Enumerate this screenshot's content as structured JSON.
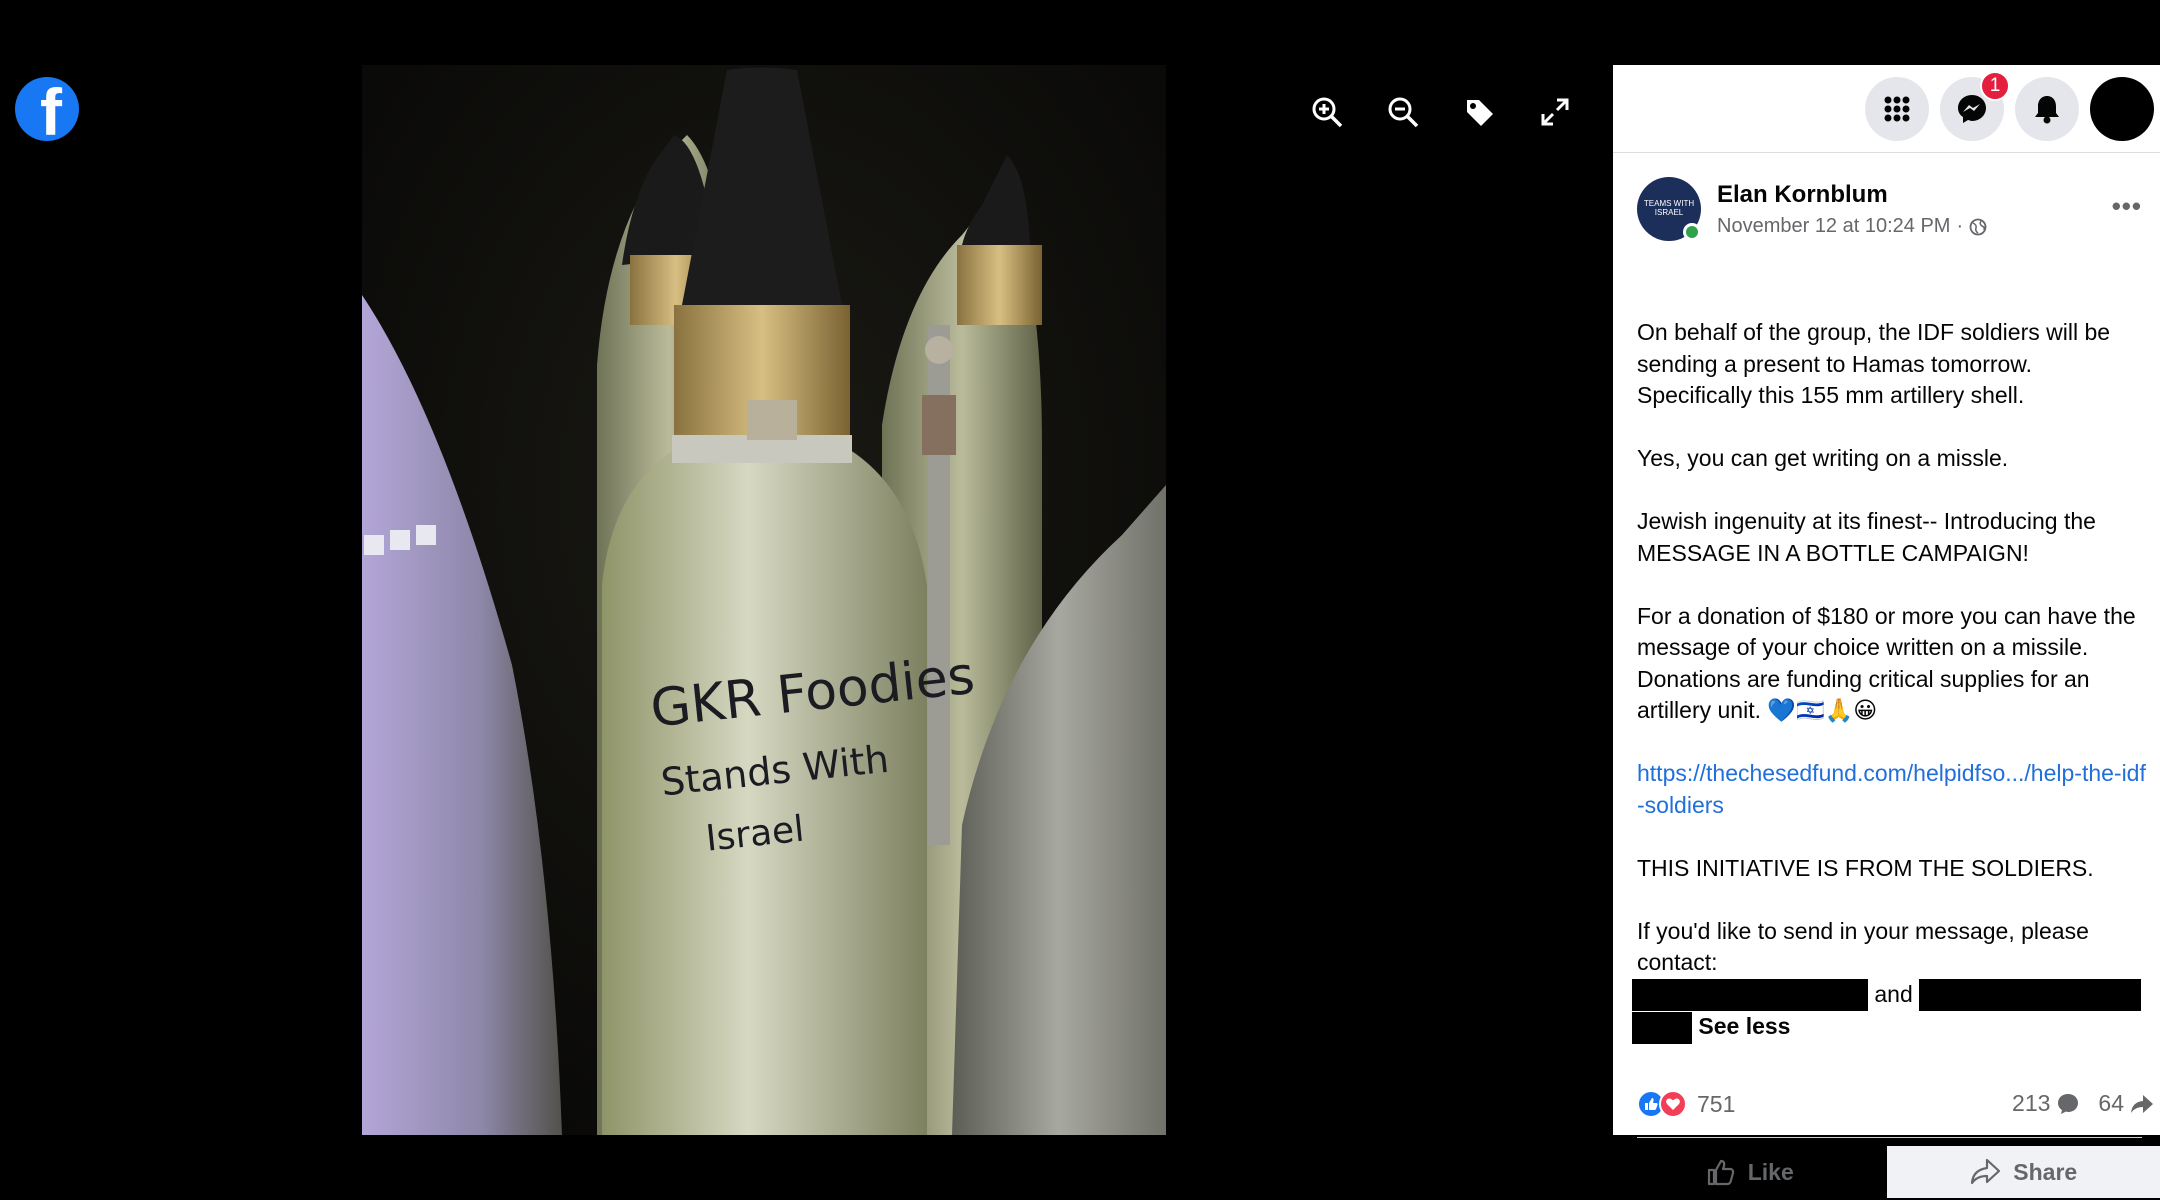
{
  "app": {
    "logo_letter": "f",
    "logo_icon": "facebook-logo"
  },
  "viewer": {
    "tools": [
      "zoom-in-icon",
      "zoom-out-icon",
      "tag-icon",
      "fullscreen-icon"
    ]
  },
  "photo": {
    "inscription_line1": "GKR Foodies",
    "inscription_line2": "Stands With",
    "inscription_line3": "Israel"
  },
  "topbar": {
    "messenger_badge": "1"
  },
  "post": {
    "author": "Elan Kornblum",
    "avatar_text": "TEAMS WITH ISRAEL",
    "timestamp": "November 12 at 10:24 PM",
    "separator": "·",
    "paragraphs": [
      "On behalf of the group, the IDF soldiers will be sending a present to Hamas tomorrow. Specifically this 155 mm artillery shell.",
      "Yes, you can get writing on a missle.",
      "Jewish ingenuity at its finest-- Introducing the MESSAGE IN A BOTTLE CAMPAIGN!",
      "For a donation of $180 or more you can have the message of your choice written on a missile. Donations are funding critical supplies for an artillery unit. 💙🇮🇱🙏😀"
    ],
    "link": "https://thechesedfund.com/helpidfso.../help-the-idf-soldiers",
    "initiative": "THIS INITIATIVE IS FROM THE SOLDIERS.",
    "contact": "If you'd like to send in your message, please contact:",
    "and": "and",
    "see_less": "See less"
  },
  "stats": {
    "reactions": "751",
    "comments": "213",
    "shares": "64"
  },
  "actions": {
    "like": "Like",
    "share": "Share"
  },
  "colors": {
    "brand": "#1877f2",
    "link": "#216fdb",
    "badge": "#e41e3f",
    "love": "#f33e58"
  }
}
